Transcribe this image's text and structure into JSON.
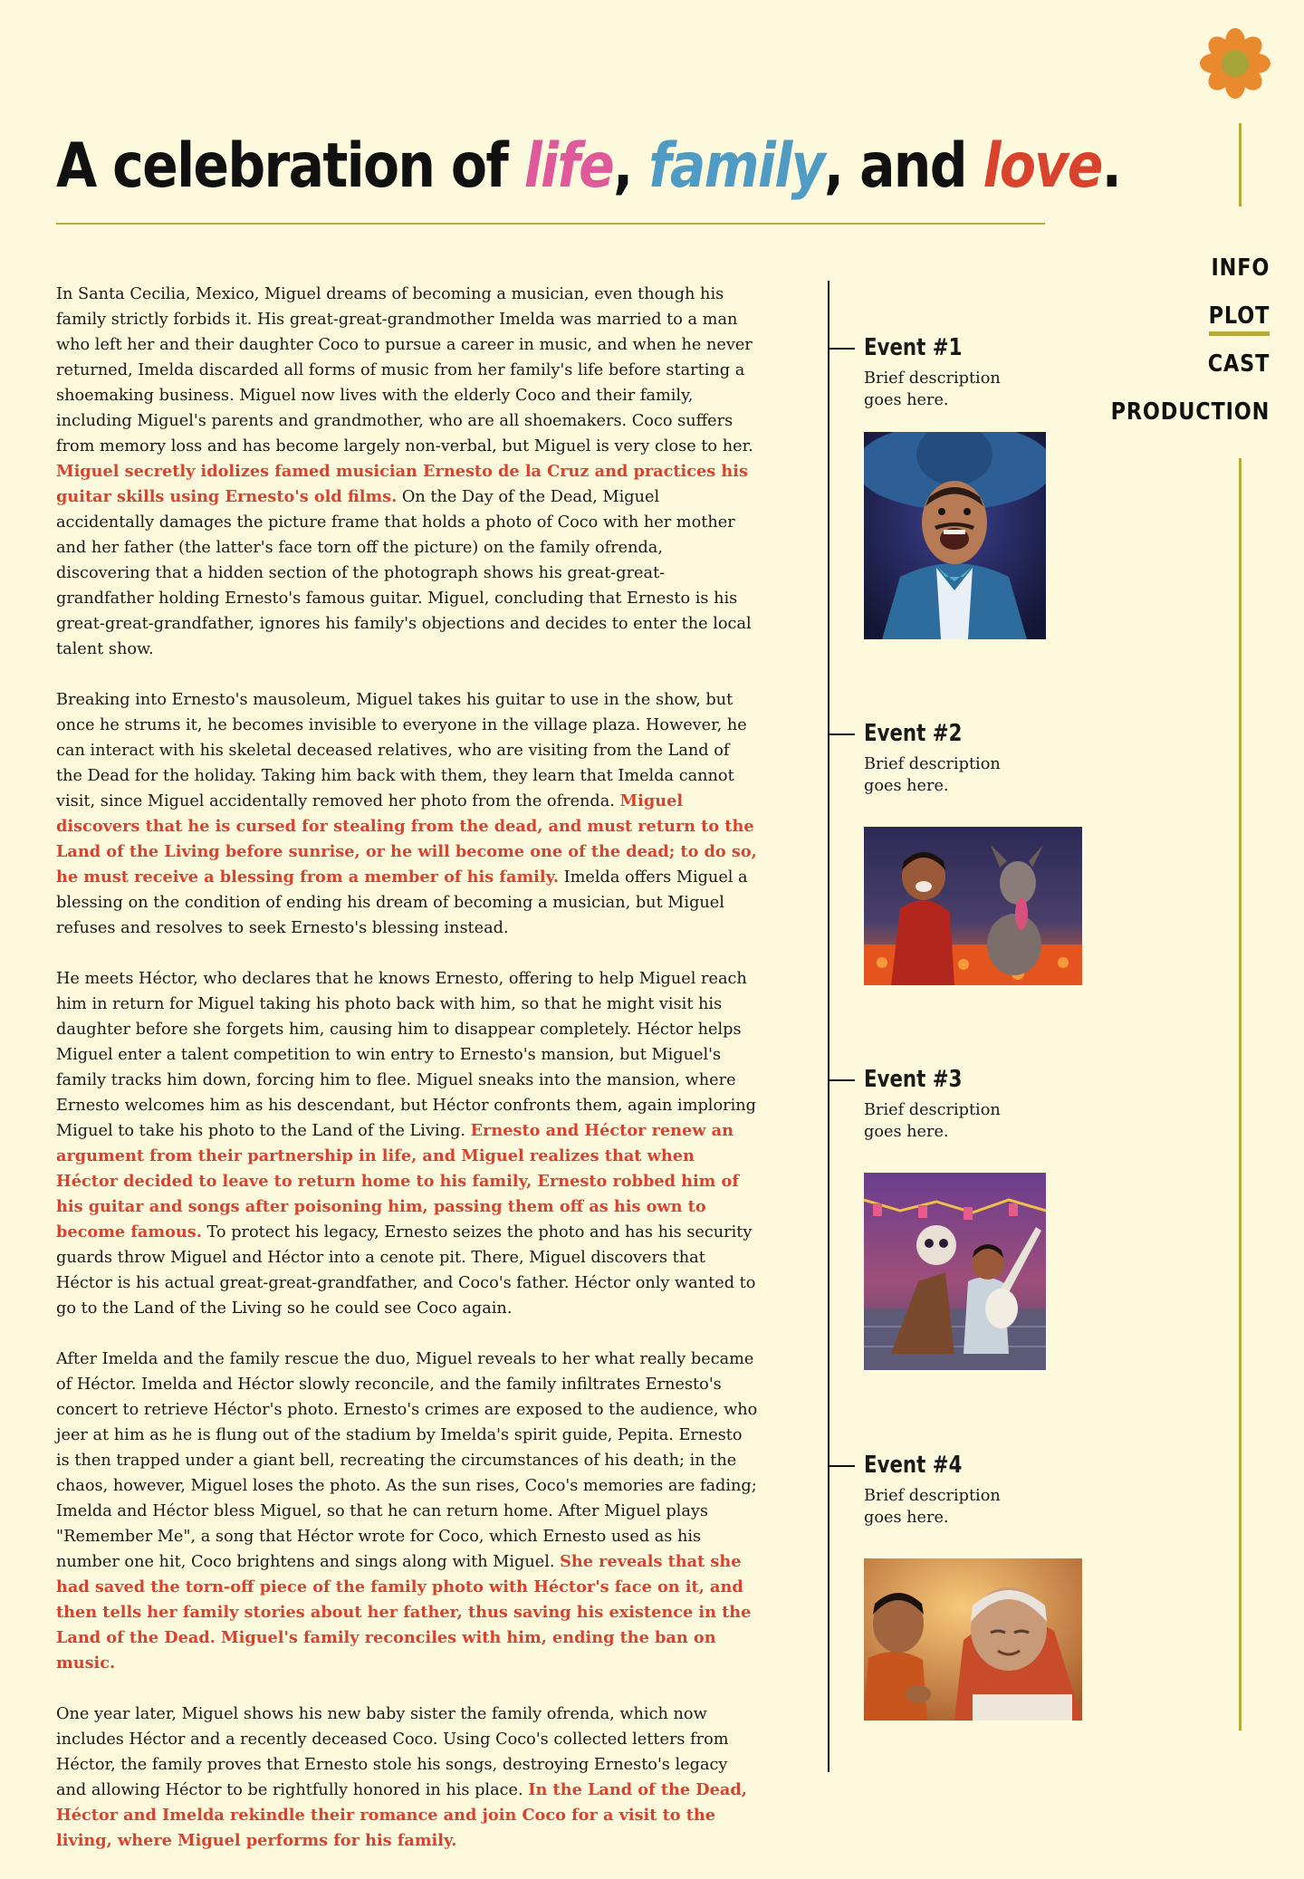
{
  "logo": {
    "icon": "flower-icon",
    "petal_color": "#e98a2f",
    "center_color": "#a7a438"
  },
  "nav": {
    "items": [
      {
        "label": "INFO",
        "active": false
      },
      {
        "label": "PLOT",
        "active": true
      },
      {
        "label": "CAST",
        "active": false
      },
      {
        "label": "PRODUCTION",
        "active": false
      }
    ],
    "accent": "#b9a83a"
  },
  "heading": {
    "prefix": "A celebration of ",
    "word1": "life",
    "sep1": ", ",
    "word2": "family",
    "sep2": ", and ",
    "word3": "love",
    "suffix": ".",
    "colors": {
      "life": "#de5a9a",
      "family": "#4f9bc4",
      "love": "#d9432e"
    }
  },
  "story": {
    "highlight_color": "#d9432e",
    "paragraphs": [
      {
        "pre": "In Santa Cecilia, Mexico, Miguel dreams of becoming a musician, even though his family strictly forbids it. His great-great-grandmother Imelda was married to a man who left her and their daughter Coco to pursue a career in music, and when he never returned, Imelda discarded all forms of music from her family's life before starting a shoemaking business. Miguel now lives with the elderly Coco and their family, including Miguel's parents and grandmother, who are all shoemakers. Coco suffers from memory loss and has become largely non-verbal, but Miguel is very close to her. ",
        "highlight": "Miguel secretly idolizes famed musician Ernesto de la Cruz and practices his guitar skills using Ernesto's old films.",
        "post": " On the Day of the Dead, Miguel accidentally damages the picture frame that holds a photo of Coco with her mother and her father (the latter's face torn off the picture) on the family ofrenda, discovering that a hidden section of the photograph shows his great-great-grandfather holding Ernesto's famous guitar. Miguel, concluding that Ernesto is his great-great-grandfather, ignores his family's objections and decides to enter the local talent show."
      },
      {
        "pre": "Breaking into Ernesto's mausoleum, Miguel takes his guitar to use in the show, but once he strums it, he becomes invisible to everyone in the village plaza. However, he can interact with his skeletal deceased relatives, who are visiting from the Land of the Dead for the holiday. Taking him back with them, they learn that Imelda cannot visit, since Miguel accidentally removed her photo from the ofrenda. ",
        "highlight": "Miguel discovers that he is cursed for stealing from the dead, and must return to the Land of the Living before sunrise, or he will become one of the dead; to do so, he must receive a blessing from a member of his family.",
        "post": " Imelda offers Miguel a blessing on the condition of ending his dream of becoming a musician, but Miguel refuses and resolves to seek Ernesto's blessing instead."
      },
      {
        "pre": "He meets Héctor, who declares that he knows Ernesto, offering to help Miguel reach him in return for Miguel taking his photo back with him, so that he might visit his daughter before she forgets him, causing him to disappear completely. Héctor helps Miguel enter a talent competition to win entry to Ernesto's mansion, but Miguel's family tracks him down, forcing him to flee. Miguel sneaks into the mansion, where Ernesto welcomes him as his descendant, but Héctor confronts them, again imploring Miguel to take his photo to the Land of the Living. ",
        "highlight": "Ernesto and Héctor renew an argument from their partnership in life, and Miguel realizes that when Héctor decided to leave to return home to his family, Ernesto robbed him of his guitar and songs after poisoning him, passing them off as his own to become famous.",
        "post": " To protect his legacy, Ernesto seizes the photo and has his security guards throw Miguel and Héctor into a cenote pit. There, Miguel discovers that Héctor is his actual great-great-grandfather, and Coco's father. Héctor only wanted to go to the Land of the Living so he could see Coco again."
      },
      {
        "pre": "After Imelda and the family rescue the duo, Miguel reveals to her what really became of Héctor. Imelda and Héctor slowly reconcile, and the family infiltrates Ernesto's concert to retrieve Héctor's photo. Ernesto's crimes are exposed to the audience, who jeer at him as he is flung out of the stadium by Imelda's spirit guide, Pepita. Ernesto is then trapped under a giant bell, recreating the circumstances of his death; in the chaos, however, Miguel loses the photo. As the sun rises, Coco's memories are fading; Imelda and Héctor bless Miguel, so that he can return home. After Miguel plays \"Remember Me\", a song that Héctor wrote for Coco, which Ernesto used as his number one hit, Coco brightens and sings along with Miguel. ",
        "highlight": "She reveals that she had saved the torn-off piece of the family photo with Héctor's face on it, and then tells her family stories about her father, thus saving his existence in the Land of the Dead. Miguel's family reconciles with him, ending the ban on music.",
        "post": ""
      },
      {
        "pre": "One year later, Miguel shows his new baby sister the family ofrenda, which now includes Héctor and a recently deceased Coco. Using Coco's collected letters from Héctor, the family proves that Ernesto stole his songs, destroying Ernesto's legacy and allowing Héctor to be rightfully honored in his place. ",
        "highlight": "In the Land of the Dead, Héctor and Imelda rekindle their romance and join Coco for a visit to the living, where Miguel performs for his family.",
        "post": ""
      }
    ]
  },
  "timeline": {
    "events": [
      {
        "title": "Event #1",
        "description": "Brief description goes here.",
        "image": "ernesto-portrait"
      },
      {
        "title": "Event #2",
        "description": "Brief description goes here.",
        "image": "miguel-and-dante"
      },
      {
        "title": "Event #3",
        "description": "Brief description goes here.",
        "image": "miguel-and-hector-dancing"
      },
      {
        "title": "Event #4",
        "description": "Brief description goes here.",
        "image": "miguel-and-coco"
      }
    ]
  }
}
